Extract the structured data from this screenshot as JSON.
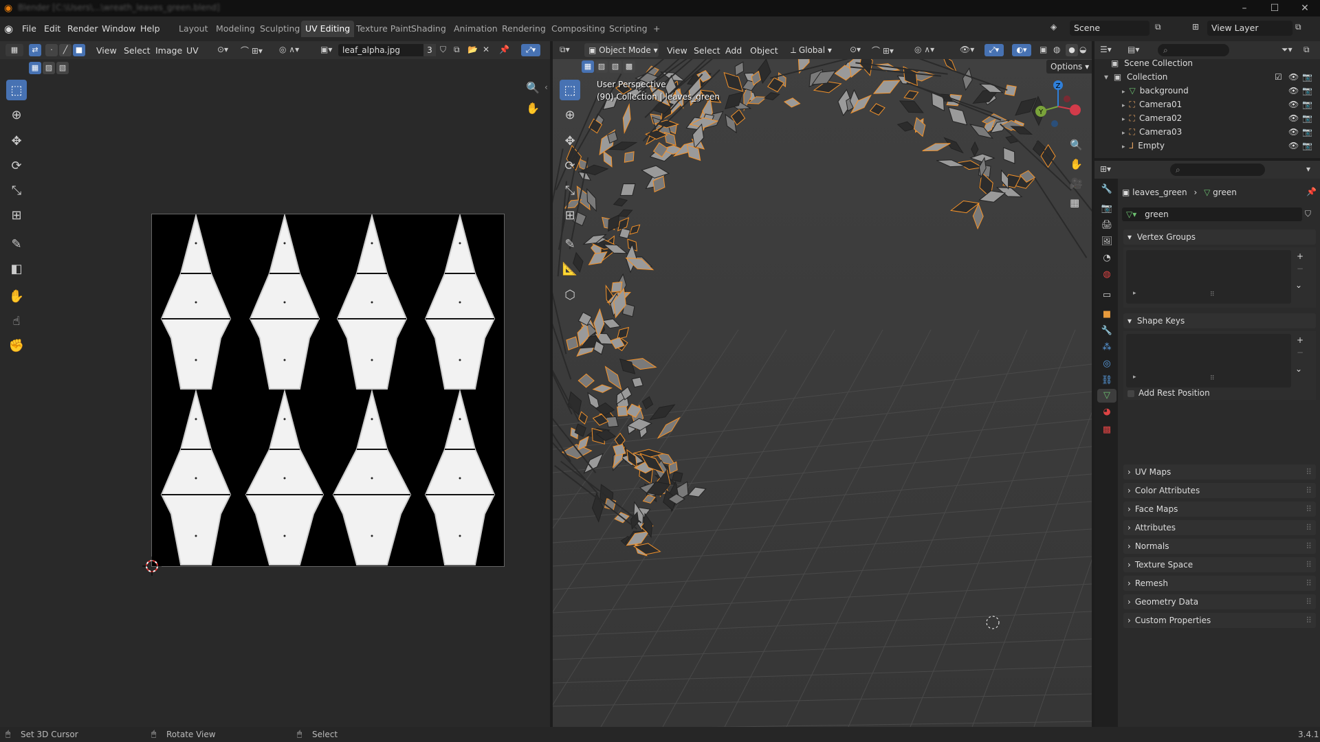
{
  "window": {
    "title": "Blender [C:\\Users\\...\\wreath_leaves_green.blend]",
    "min": "–",
    "max": "☐",
    "close": "✕"
  },
  "menus": [
    "File",
    "Edit",
    "Render",
    "Window",
    "Help"
  ],
  "workspaces": [
    "Layout",
    "Modeling",
    "Sculpting",
    "UV Editing",
    "Texture Paint",
    "Shading",
    "Animation",
    "Rendering",
    "Compositing",
    "Scripting",
    "+"
  ],
  "active_workspace": "UV Editing",
  "scene": {
    "name": "Scene",
    "view_layer": "View Layer"
  },
  "uv_editor": {
    "menus": [
      "View",
      "Select",
      "Image",
      "UV"
    ],
    "image_name": "leaf_alpha.jpg",
    "image_users": "3"
  },
  "viewport": {
    "mode": "Object Mode",
    "menus": [
      "View",
      "Select",
      "Add",
      "Object"
    ],
    "orientation": "Global",
    "options": "Options",
    "perspective": "User Perspective",
    "collection_info": "(90) Collection | leaves_green",
    "axis_x": "X",
    "axis_y": "Y",
    "axis_z": "Z"
  },
  "outliner": {
    "root": "Scene Collection",
    "collection": "Collection",
    "items": [
      {
        "name": "background",
        "color": "#6cc070"
      },
      {
        "name": "Camera01",
        "color": "#e0a060"
      },
      {
        "name": "Camera02",
        "color": "#e0a060"
      },
      {
        "name": "Camera03",
        "color": "#e0a060"
      },
      {
        "name": "Empty",
        "color": "#e0a060"
      }
    ]
  },
  "properties": {
    "object_name": "leaves_green",
    "mesh_name": "green",
    "data_field": "green",
    "panels_open": [
      "Vertex Groups",
      "Shape Keys"
    ],
    "add_rest_position": "Add Rest Position",
    "panels_closed": [
      "UV Maps",
      "Color Attributes",
      "Face Maps",
      "Attributes",
      "Normals",
      "Texture Space",
      "Remesh",
      "Geometry Data",
      "Custom Properties"
    ]
  },
  "status_bar": {
    "left": "Set 3D Cursor",
    "middle": "Rotate View",
    "right": "Select",
    "version": "3.4.1"
  },
  "colors": {
    "accent": "#4772b3",
    "selection": "#f5932a"
  }
}
